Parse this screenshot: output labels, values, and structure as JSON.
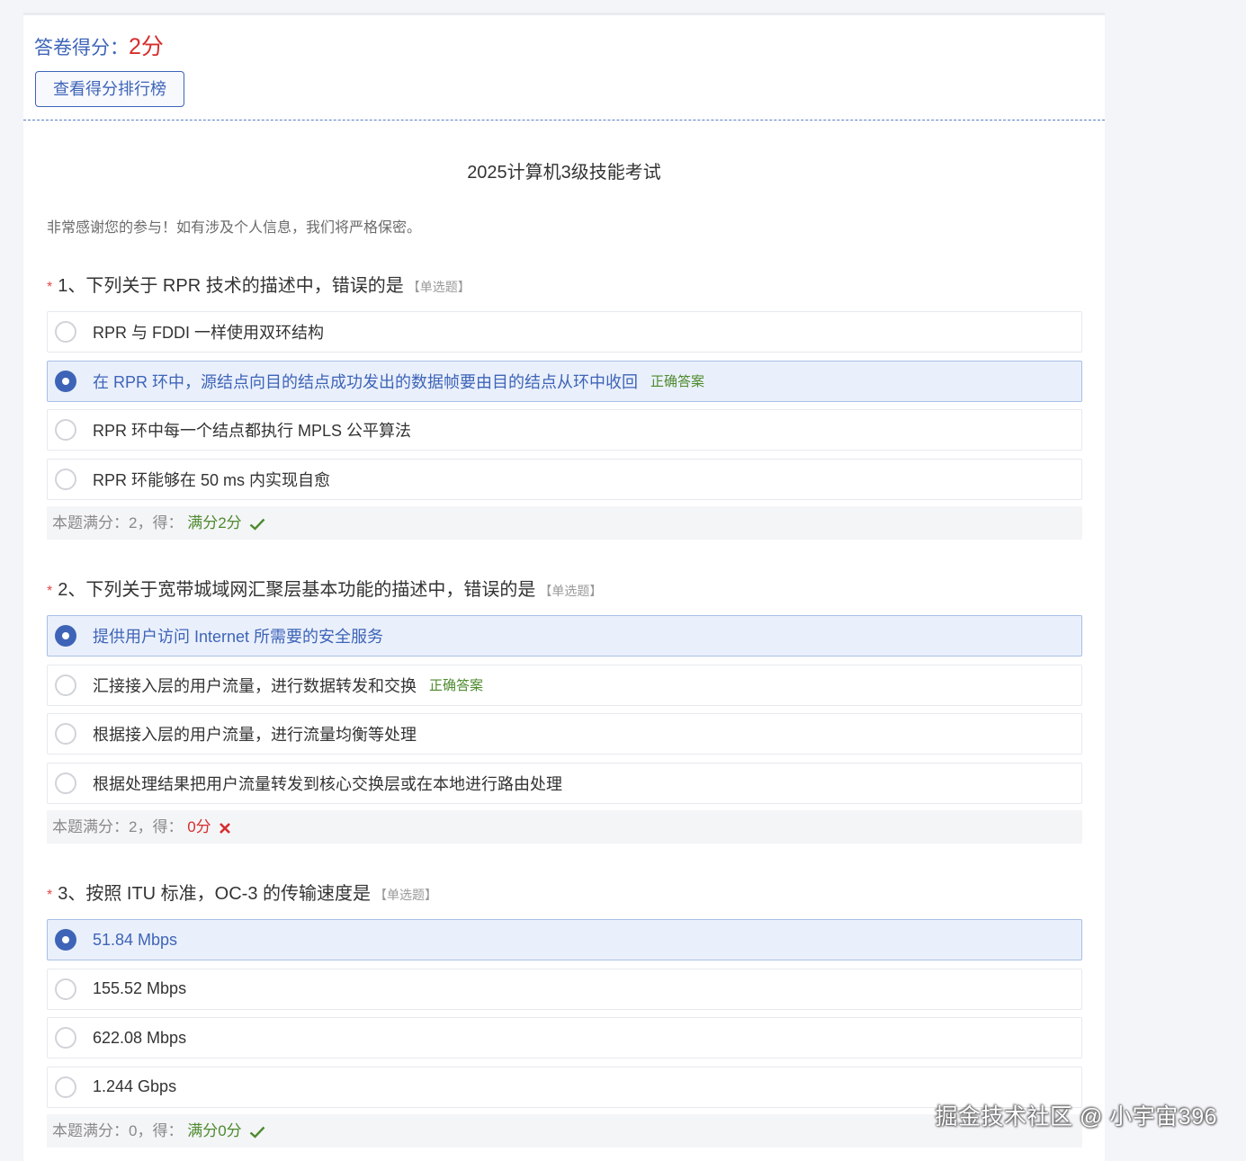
{
  "score": {
    "label": "答卷得分：",
    "value": "2分"
  },
  "rank_button": "查看得分排行榜",
  "survey": {
    "title": "2025计算机3级技能考试",
    "description": "非常感谢您的参与！如有涉及个人信息，我们将严格保密。"
  },
  "correct_label": "正确答案",
  "questions": [
    {
      "required_mark": "*",
      "title": "1、下列关于 RPR 技术的描述中，错误的是",
      "type": "【单选题】",
      "options": [
        "RPR 与 FDDI 一样使用双环结构",
        "在 RPR 环中，源结点向目的结点成功发出的数据帧要由目的结点从环中收回",
        "RPR 环中每一个结点都执行 MPLS 公平算法",
        "RPR 环能够在 50 ms 内实现自愈"
      ],
      "selected_index": 1,
      "correct_index": 1,
      "result_label": "本题满分：2，得：",
      "result_value": "满分2分",
      "result_correct": true
    },
    {
      "required_mark": "*",
      "title": "2、下列关于宽带城域网汇聚层基本功能的描述中，错误的是",
      "type": "【单选题】",
      "options": [
        "提供用户访问 Internet 所需要的安全服务",
        "汇接接入层的用户流量，进行数据转发和交换",
        "根据接入层的用户流量，进行流量均衡等处理",
        "根据处理结果把用户流量转发到核心交换层或在本地进行路由处理"
      ],
      "selected_index": 0,
      "correct_index": 1,
      "result_label": "本题满分：2，得：",
      "result_value": "0分",
      "result_correct": false
    },
    {
      "required_mark": "*",
      "title": "3、按照 ITU 标准，OC-3 的传输速度是",
      "type": "【单选题】",
      "options": [
        "51.84 Mbps",
        "155.52 Mbps",
        "622.08 Mbps",
        "1.244 Gbps"
      ],
      "selected_index": 0,
      "correct_index": -1,
      "result_label": "本题满分：0，得：",
      "result_value": "满分0分",
      "result_correct": true
    }
  ],
  "watermark": "掘金技术社区 @ 小宇宙396",
  "colors": {
    "accent": "#3e64b8",
    "correct": "#4e8a2e",
    "wrong": "#d62e2e"
  }
}
